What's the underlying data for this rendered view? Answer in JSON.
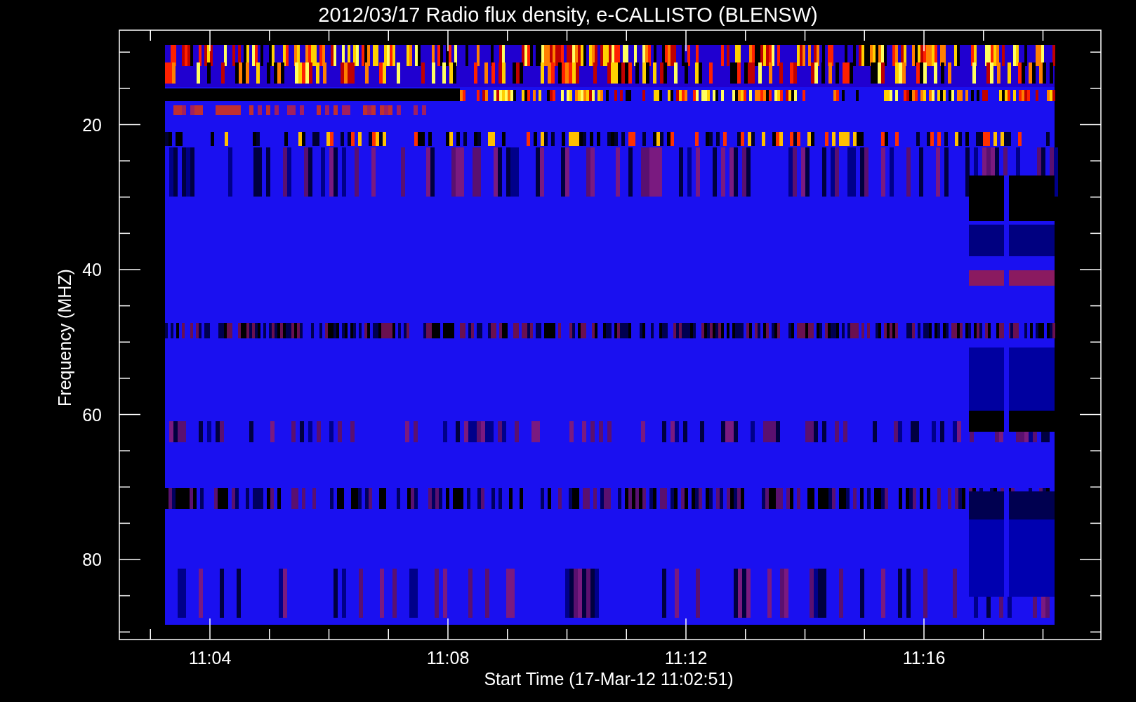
{
  "title": "2012/03/17  Radio flux density, e-CALLISTO (BLENSW)",
  "y_axis": {
    "label": "Frequency (MHZ)",
    "ticks": [
      "20",
      "40",
      "60",
      "80"
    ]
  },
  "x_axis": {
    "label": "Start Time (17-Mar-12 11:02:51)",
    "ticks": [
      "11:04",
      "11:08",
      "11:12",
      "11:16"
    ]
  }
}
